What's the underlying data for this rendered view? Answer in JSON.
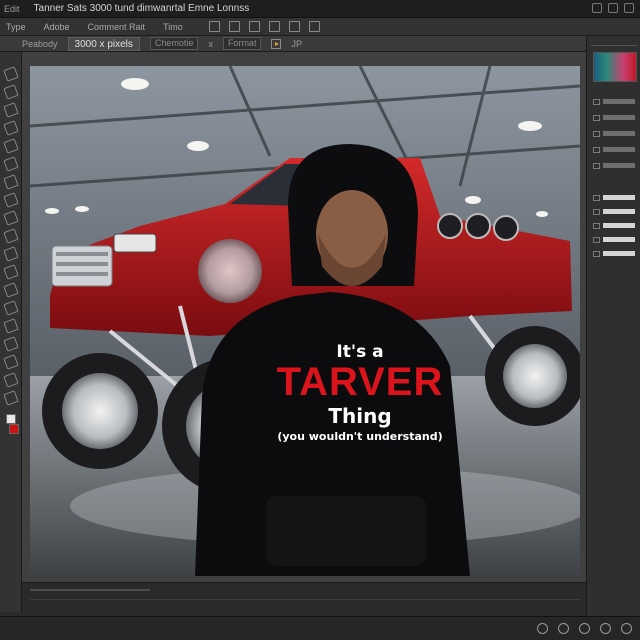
{
  "window": {
    "app_tag": "Edit",
    "title": "Tanner Sats 3000 tund dimwanrtal Emne Lonnss"
  },
  "menubar": {
    "items": [
      "Type",
      "Adobe",
      "Comment Rait",
      "Timo"
    ]
  },
  "options": {
    "preset_label": "Peabody",
    "size_value": "3000 x pixels",
    "mode_label": "Chemotie",
    "close_glyph": "x",
    "format_label": "Format",
    "format_value": "JP"
  },
  "icons": {
    "toolbar": [
      "move-tool-icon",
      "marquee-tool-icon",
      "lasso-tool-icon",
      "crop-tool-icon",
      "eyedropper-tool-icon",
      "healing-tool-icon",
      "brush-tool-icon",
      "stamp-tool-icon",
      "history-brush-icon",
      "eraser-tool-icon",
      "gradient-tool-icon",
      "blur-tool-icon",
      "dodge-tool-icon",
      "pen-tool-icon",
      "type-tool-icon",
      "path-select-icon",
      "shape-tool-icon",
      "hand-tool-icon",
      "zoom-tool-icon"
    ],
    "bottom": [
      "record-icon",
      "pan-icon",
      "target-icon",
      "settings-icon",
      "info-icon"
    ]
  },
  "swatches": {
    "foreground": "#e8e8e8",
    "background": "#cc1111"
  },
  "image": {
    "shirt_line1": "It's a",
    "shirt_line2": "TARVER",
    "shirt_line3": "Thing",
    "shirt_line4": "(you wouldn't understand)",
    "shirt_accent": "#d9141c",
    "truck_color": "#b3141c"
  }
}
